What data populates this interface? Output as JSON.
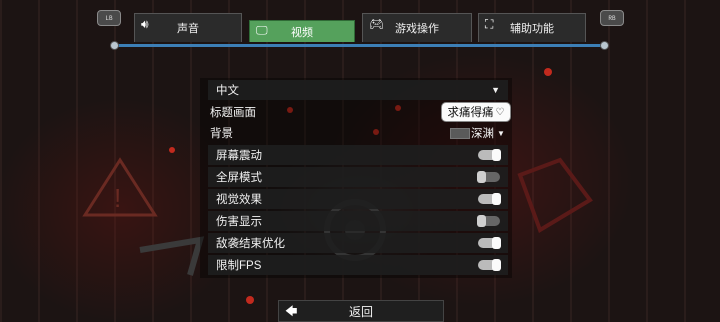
{
  "tabs": [
    {
      "label": "声音",
      "icon": "speaker-icon",
      "active": false
    },
    {
      "label": "视频",
      "icon": "monitor-icon",
      "active": true
    },
    {
      "label": "游戏操作",
      "icon": "gamepad-icon",
      "active": false
    },
    {
      "label": "辅助功能",
      "icon": "accessibility-icon",
      "active": false
    }
  ],
  "corner_buttons": {
    "left": "LB",
    "right": "RB"
  },
  "settings": {
    "language": {
      "label": "中文"
    },
    "title_screen": {
      "label": "标题画面",
      "value": "求痛得痛"
    },
    "background": {
      "label": "背景",
      "value": "深渊"
    },
    "toggles": [
      {
        "label": "屏幕震动",
        "on": true
      },
      {
        "label": "全屏模式",
        "on": false
      },
      {
        "label": "视觉效果",
        "on": true
      },
      {
        "label": "伤害显示",
        "on": false
      },
      {
        "label": "敌袭结束优化",
        "on": true
      },
      {
        "label": "限制FPS",
        "on": true
      }
    ]
  },
  "footer": {
    "back_label": "返回"
  },
  "colors": {
    "active_tab": "#55a15c",
    "rail": "#3c7fb6",
    "background": "#1d1514"
  }
}
